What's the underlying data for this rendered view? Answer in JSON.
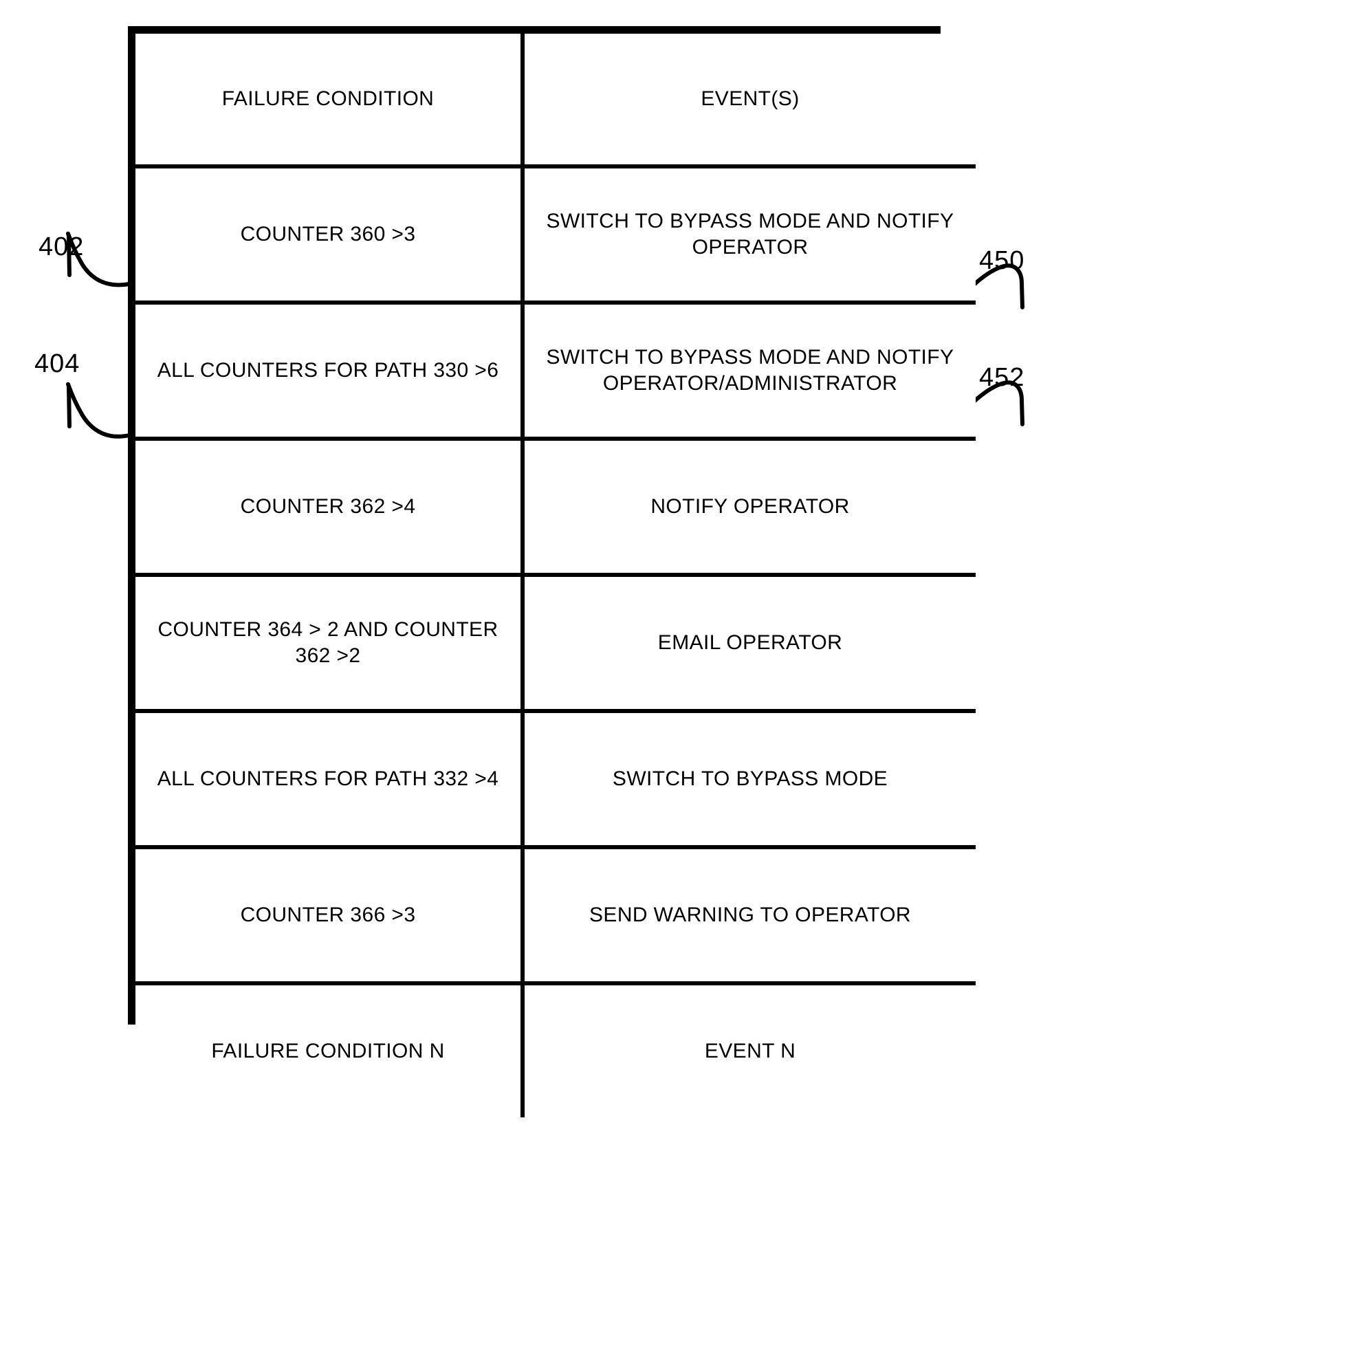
{
  "figure": {
    "type": "patent-table-figure",
    "background_color": "#ffffff",
    "line_color": "#000000"
  },
  "table": {
    "columns": [
      {
        "key": "failure_condition",
        "header": "FAILURE CONDITION"
      },
      {
        "key": "events",
        "header": "EVENT(S)"
      }
    ],
    "rows": [
      {
        "failure_condition": "COUNTER 360 >3",
        "events": "SWITCH TO BYPASS MODE AND NOTIFY OPERATOR"
      },
      {
        "failure_condition": "ALL COUNTERS FOR PATH 330 >6",
        "events": "SWITCH TO BYPASS MODE AND NOTIFY OPERATOR/ADMINISTRATOR"
      },
      {
        "failure_condition": "COUNTER 362 >4",
        "events": "NOTIFY OPERATOR"
      },
      {
        "failure_condition": "COUNTER 364 > 2 AND COUNTER 362 >2",
        "events": "EMAIL OPERATOR"
      },
      {
        "failure_condition": "ALL COUNTERS FOR PATH 332 >4",
        "events": "SWITCH TO BYPASS MODE"
      },
      {
        "failure_condition": "COUNTER 366 >3",
        "events": "SEND WARNING TO OPERATOR"
      },
      {
        "failure_condition": "FAILURE CONDITION N",
        "events": "EVENT N"
      }
    ]
  },
  "reference_numerals": {
    "left": [
      {
        "label": "402",
        "points_to": "row 1 failure condition cell"
      },
      {
        "label": "404",
        "points_to": "row 2 failure condition cell"
      }
    ],
    "right": [
      {
        "label": "450",
        "points_to": "row 1 events cell"
      },
      {
        "label": "452",
        "points_to": "row 2 events cell"
      }
    ]
  }
}
